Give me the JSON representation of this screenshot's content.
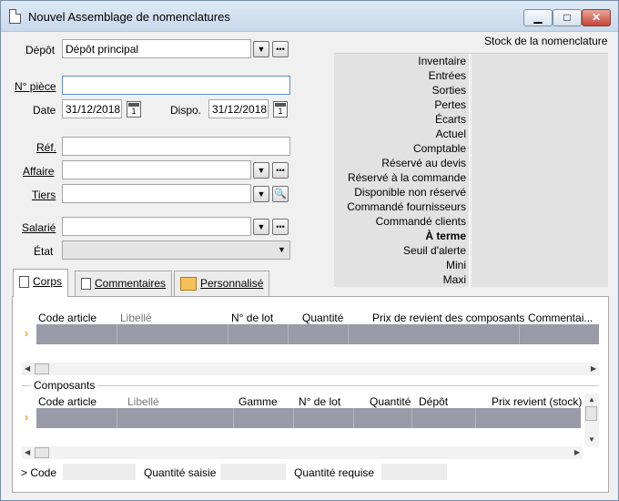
{
  "window": {
    "title": "Nouvel Assemblage de nomenclatures",
    "minimize_glyph": "▁",
    "maximize_glyph": "□",
    "close_glyph": "✕"
  },
  "form": {
    "depot_label": "Dépôt",
    "depot_value": "Dépôt principal",
    "piece_label": "N° pièce",
    "piece_value": "",
    "date_label": "Date",
    "date_value": "31/12/2018",
    "dispo_label": "Dispo.",
    "dispo_value": "31/12/2018",
    "ref_label": "Réf.",
    "affaire_label": "Affaire",
    "tiers_label": "Tiers",
    "salarie_label": "Salarié",
    "etat_label": "État"
  },
  "stock": {
    "title": "Stock de la nomenclature",
    "rows": [
      {
        "label": "Inventaire",
        "value": ""
      },
      {
        "label": "Entrées",
        "value": ""
      },
      {
        "label": "Sorties",
        "value": ""
      },
      {
        "label": "Pertes",
        "value": ""
      },
      {
        "label": "Écarts",
        "value": ""
      },
      {
        "label": "Actuel",
        "value": ""
      },
      {
        "label": "Comptable",
        "value": ""
      },
      {
        "label": "Réservé au devis",
        "value": ""
      },
      {
        "label": "Réservé à la commande",
        "value": ""
      },
      {
        "label": "Disponible non réservé",
        "value": ""
      },
      {
        "label": "Commandé fournisseurs",
        "value": ""
      },
      {
        "label": "Commandé clients",
        "value": ""
      },
      {
        "label": "À terme",
        "value": "",
        "bold": true
      },
      {
        "label": "Seuil d'alerte",
        "value": ""
      },
      {
        "label": "Mini",
        "value": ""
      },
      {
        "label": "Maxi",
        "value": ""
      }
    ]
  },
  "tabs": [
    "Corps",
    "Commentaires",
    "Personnalisé"
  ],
  "corps_grid": {
    "headers": [
      "Code article",
      "Libellé",
      "N° de lot",
      "Quantité",
      "Prix de revient des composants",
      "Commentai..."
    ]
  },
  "composants": {
    "label": "Composants",
    "headers": [
      "Code article",
      "Libellé",
      "Gamme",
      "N° de lot",
      "Quantité",
      "Dépôt",
      "Prix revient (stock)"
    ]
  },
  "footer": {
    "code_label": "> Code",
    "qte_saisie_label": "Quantité saisie",
    "qte_requise_label": "Quantité requise"
  },
  "colors": {
    "grid_row": "#9a9aa8",
    "row_marker": "#e0a020"
  }
}
